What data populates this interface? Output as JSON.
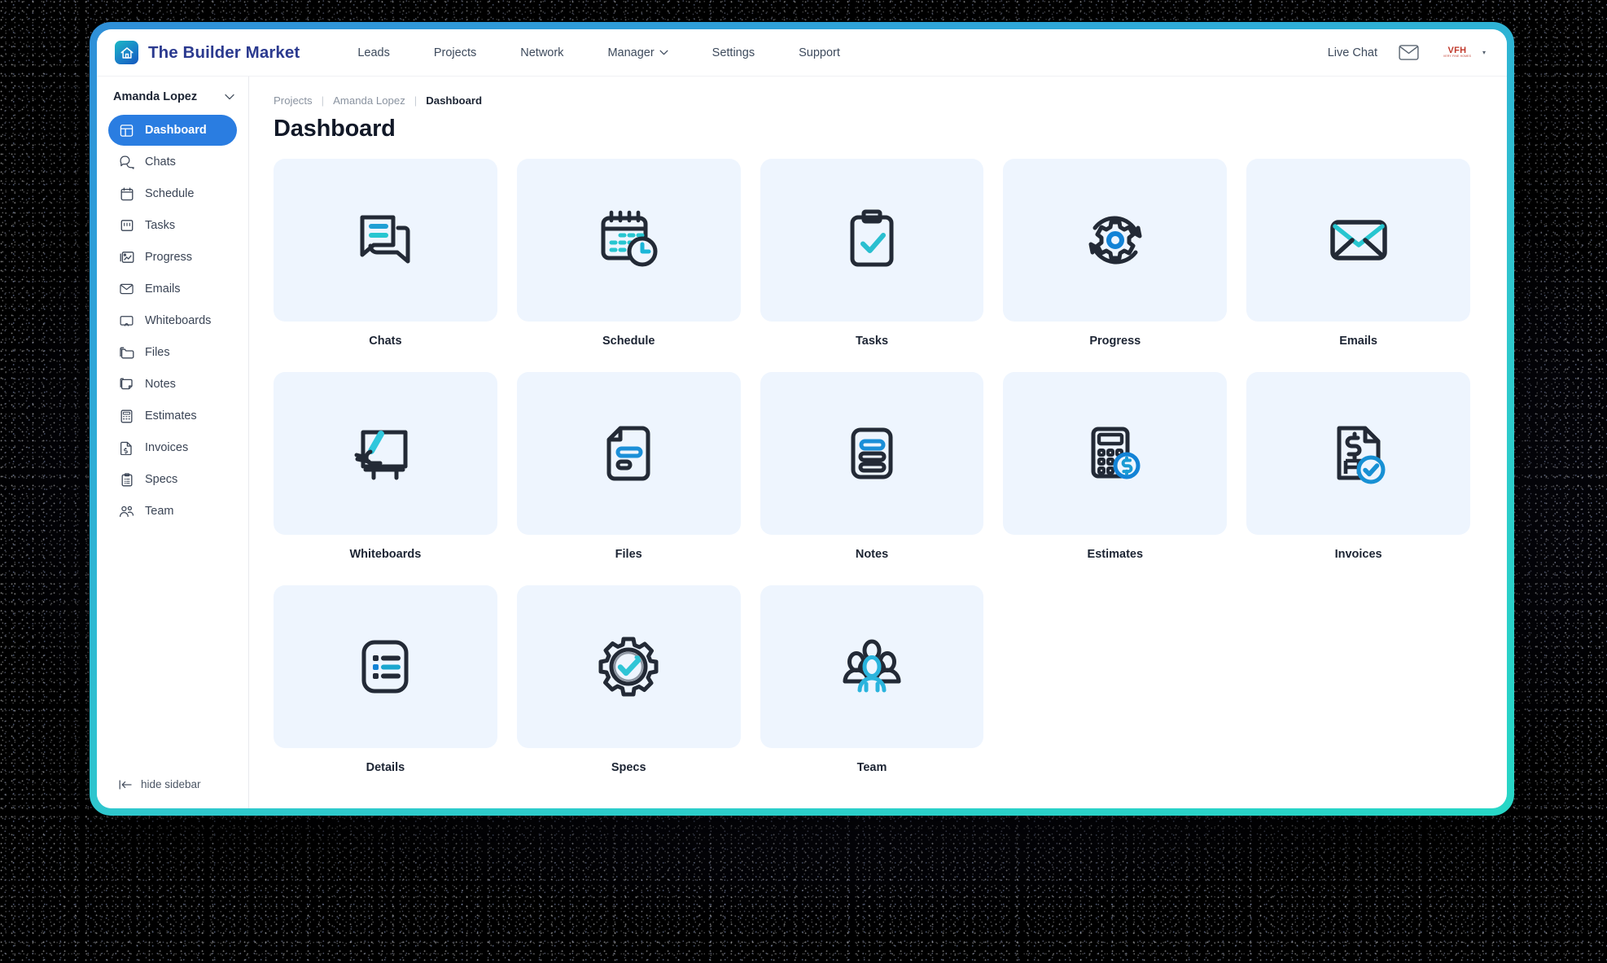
{
  "header": {
    "brand": "The Builder Market",
    "brand_logo_icon": "house-app-logo",
    "nav": [
      {
        "label": "Leads",
        "icon": "",
        "has_caret": false
      },
      {
        "label": "Projects",
        "icon": "",
        "has_caret": false
      },
      {
        "label": "Network",
        "icon": "",
        "has_caret": false
      },
      {
        "label": "Manager",
        "icon": "chevron-down-icon",
        "has_caret": true
      },
      {
        "label": "Settings",
        "icon": "",
        "has_caret": false
      },
      {
        "label": "Support",
        "icon": "",
        "has_caret": false
      }
    ],
    "live_chat": "Live Chat",
    "mail_icon": "envelope-icon",
    "avatar_logo_top": "VFH",
    "avatar_logo_bottom": "VERY FINE HOMES",
    "avatar_caret_icon": "chevron-down-icon"
  },
  "sidebar": {
    "user": "Amanda Lopez",
    "user_caret_icon": "chevron-down-icon",
    "items": [
      {
        "label": "Dashboard",
        "icon": "dashboard-icon",
        "active": true
      },
      {
        "label": "Chats",
        "icon": "chat-bubbles-icon",
        "active": false
      },
      {
        "label": "Schedule",
        "icon": "calendar-icon",
        "active": false
      },
      {
        "label": "Tasks",
        "icon": "tasks-icon",
        "active": false
      },
      {
        "label": "Progress",
        "icon": "progress-icon",
        "active": false
      },
      {
        "label": "Emails",
        "icon": "envelope-icon",
        "active": false
      },
      {
        "label": "Whiteboards",
        "icon": "whiteboard-icon",
        "active": false
      },
      {
        "label": "Files",
        "icon": "folder-icon",
        "active": false
      },
      {
        "label": "Notes",
        "icon": "note-icon",
        "active": false
      },
      {
        "label": "Estimates",
        "icon": "calculator-icon",
        "active": false
      },
      {
        "label": "Invoices",
        "icon": "invoice-icon",
        "active": false
      },
      {
        "label": "Specs",
        "icon": "clipboard-icon",
        "active": false
      },
      {
        "label": "Team",
        "icon": "people-icon",
        "active": false
      }
    ],
    "hide_label": "hide sidebar",
    "hide_icon": "collapse-left-icon"
  },
  "breadcrumb": {
    "items": [
      "Projects",
      "Amanda Lopez",
      "Dashboard"
    ],
    "separator": "|"
  },
  "page": {
    "title": "Dashboard"
  },
  "tiles": [
    {
      "label": "Chats",
      "icon": "chat-bubbles-icon"
    },
    {
      "label": "Schedule",
      "icon": "calendar-clock-icon"
    },
    {
      "label": "Tasks",
      "icon": "clipboard-check-icon"
    },
    {
      "label": "Progress",
      "icon": "gear-refresh-icon"
    },
    {
      "label": "Emails",
      "icon": "envelope-icon"
    },
    {
      "label": "Whiteboards",
      "icon": "whiteboard-hand-icon"
    },
    {
      "label": "Files",
      "icon": "document-icon"
    },
    {
      "label": "Notes",
      "icon": "notes-lines-icon"
    },
    {
      "label": "Estimates",
      "icon": "calculator-dollar-icon"
    },
    {
      "label": "Invoices",
      "icon": "invoice-check-icon"
    },
    {
      "label": "Details",
      "icon": "list-details-icon"
    },
    {
      "label": "Specs",
      "icon": "gear-check-icon"
    },
    {
      "label": "Team",
      "icon": "team-people-icon"
    }
  ],
  "colors": {
    "accent_blue": "#2a7de1",
    "brand_navy": "#2b3a8f",
    "tile_bg": "#eef5fe",
    "icon_dark": "#232a36",
    "icon_teal": "#27c6d0",
    "icon_blue": "#1383d6",
    "frame_gradient_start": "#2f8fd8",
    "frame_gradient_end": "#27d6c6",
    "logo_red": "#c0392b"
  }
}
